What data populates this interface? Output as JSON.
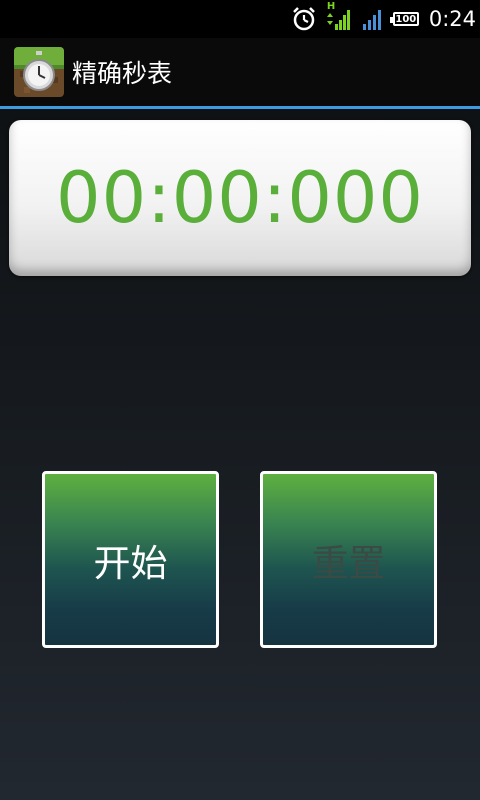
{
  "status_bar": {
    "time": "0:24",
    "battery_level": "100",
    "network_type": "H",
    "icons": [
      "alarm-icon",
      "mobile-data-signal-icon",
      "cellular-signal-icon",
      "battery-icon"
    ]
  },
  "app": {
    "title": "精确秒表",
    "icon": "stopwatch-app-icon",
    "accent_color": "#3d9be0"
  },
  "timer": {
    "display": "00:00:000",
    "text_color": "#5aaf3a"
  },
  "buttons": {
    "start_label": "开始",
    "reset_label": "重置",
    "reset_enabled": false
  }
}
